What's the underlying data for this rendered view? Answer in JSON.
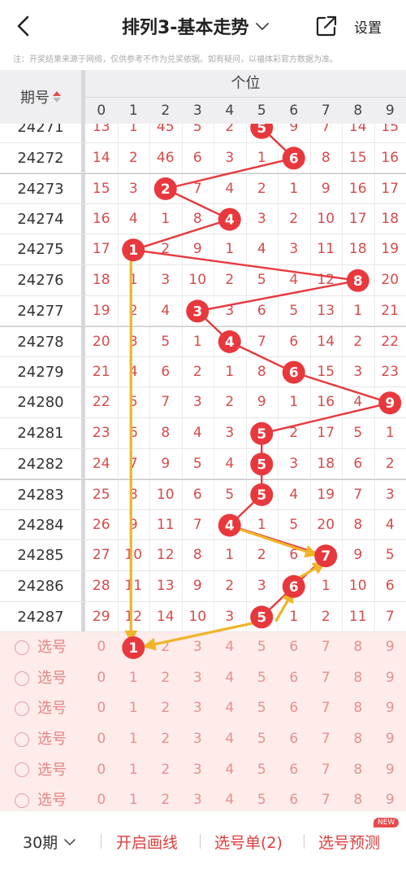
{
  "header": {
    "title": "排列3-基本走势",
    "settings_label": "设置"
  },
  "note": "注：开奖结果来源于网络，仅供参考不作为兑奖依据。如有疑问，以福体彩官方数据为准。",
  "table": {
    "period_header": "期号",
    "group_label": "个位",
    "columns": [
      "0",
      "1",
      "2",
      "3",
      "4",
      "5",
      "6",
      "7",
      "8",
      "9"
    ],
    "partial_top_row": {
      "period": "24271",
      "hit": 5,
      "values": [
        "13",
        "1",
        "45",
        "5",
        "2",
        "5",
        "9",
        "7",
        "14",
        "15"
      ]
    },
    "rows": [
      {
        "period": "24272",
        "hit": 6,
        "values": [
          "14",
          "2",
          "46",
          "6",
          "3",
          "1",
          "6",
          "8",
          "15",
          "16"
        ]
      },
      {
        "period": "24273",
        "hit": 2,
        "values": [
          "15",
          "3",
          "2",
          "7",
          "4",
          "2",
          "1",
          "9",
          "16",
          "17"
        ]
      },
      {
        "period": "24274",
        "hit": 4,
        "values": [
          "16",
          "4",
          "1",
          "8",
          "4",
          "3",
          "2",
          "10",
          "17",
          "18"
        ]
      },
      {
        "period": "24275",
        "hit": 1,
        "values": [
          "17",
          "1",
          "2",
          "9",
          "1",
          "4",
          "3",
          "11",
          "18",
          "19"
        ]
      },
      {
        "period": "24276",
        "hit": 8,
        "values": [
          "18",
          "1",
          "3",
          "10",
          "2",
          "5",
          "4",
          "12",
          "8",
          "20"
        ]
      },
      {
        "period": "24277",
        "hit": 3,
        "values": [
          "19",
          "2",
          "4",
          "3",
          "3",
          "6",
          "5",
          "13",
          "1",
          "21"
        ]
      },
      {
        "period": "24278",
        "hit": 4,
        "values": [
          "20",
          "3",
          "5",
          "1",
          "4",
          "7",
          "6",
          "14",
          "2",
          "22"
        ]
      },
      {
        "period": "24279",
        "hit": 6,
        "values": [
          "21",
          "4",
          "6",
          "2",
          "1",
          "8",
          "6",
          "15",
          "3",
          "23"
        ]
      },
      {
        "period": "24280",
        "hit": 9,
        "values": [
          "22",
          "5",
          "7",
          "3",
          "2",
          "9",
          "1",
          "16",
          "4",
          "9"
        ]
      },
      {
        "period": "24281",
        "hit": 5,
        "values": [
          "23",
          "6",
          "8",
          "4",
          "3",
          "5",
          "2",
          "17",
          "5",
          "1"
        ]
      },
      {
        "period": "24282",
        "hit": 5,
        "values": [
          "24",
          "7",
          "9",
          "5",
          "4",
          "5",
          "3",
          "18",
          "6",
          "2"
        ]
      },
      {
        "period": "24283",
        "hit": 5,
        "values": [
          "25",
          "8",
          "10",
          "6",
          "5",
          "5",
          "4",
          "19",
          "7",
          "3"
        ]
      },
      {
        "period": "24284",
        "hit": 4,
        "values": [
          "26",
          "9",
          "11",
          "7",
          "4",
          "1",
          "5",
          "20",
          "8",
          "4"
        ]
      },
      {
        "period": "24285",
        "hit": 7,
        "values": [
          "27",
          "10",
          "12",
          "8",
          "1",
          "2",
          "6",
          "7",
          "9",
          "5"
        ]
      },
      {
        "period": "24286",
        "hit": 6,
        "values": [
          "28",
          "11",
          "13",
          "9",
          "2",
          "3",
          "6",
          "1",
          "10",
          "6"
        ]
      },
      {
        "period": "24287",
        "hit": 5,
        "values": [
          "29",
          "12",
          "14",
          "10",
          "3",
          "5",
          "1",
          "2",
          "11",
          "7"
        ]
      }
    ],
    "selection_rows": [
      {
        "label": "选号",
        "selected": 1
      },
      {
        "label": "选号",
        "selected": null
      },
      {
        "label": "选号",
        "selected": null
      },
      {
        "label": "选号",
        "selected": null
      },
      {
        "label": "选号",
        "selected": null
      },
      {
        "label": "选号",
        "selected": null
      }
    ]
  },
  "colors": {
    "hit_ball": "#e8383d",
    "trend_line": "#e8383d",
    "annotation_arrow": "#f0b429",
    "miss_text": "#d84a4a",
    "selection_bg": "#fdecea"
  },
  "footer": {
    "period_select": "30期",
    "draw_line": "开启画线",
    "selection_list": "选号单(2)",
    "prediction": "选号预测",
    "new_badge": "NEW"
  }
}
